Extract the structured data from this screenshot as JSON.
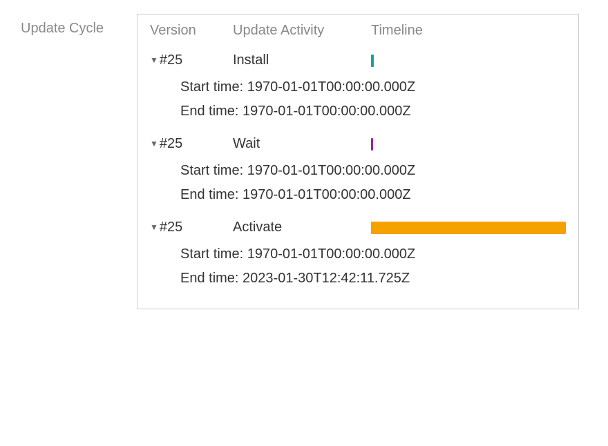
{
  "label": "Update Cycle",
  "headers": {
    "version": "Version",
    "activity": "Update Activity",
    "timeline": "Timeline"
  },
  "time_labels": {
    "start": "Start time:",
    "end": "End time:"
  },
  "entries": [
    {
      "version": "#25",
      "activity": "Install",
      "bar_color": "#17a2a2",
      "bar_class": "thin",
      "start": "1970-01-01T00:00:00.000Z",
      "end": "1970-01-01T00:00:00.000Z"
    },
    {
      "version": "#25",
      "activity": "Wait",
      "bar_color": "#a020a0",
      "bar_class": "tiny",
      "start": "1970-01-01T00:00:00.000Z",
      "end": "1970-01-01T00:00:00.000Z"
    },
    {
      "version": "#25",
      "activity": "Activate",
      "bar_color": "#f5a100",
      "bar_class": "full",
      "start": "1970-01-01T00:00:00.000Z",
      "end": "2023-01-30T12:42:11.725Z"
    }
  ]
}
